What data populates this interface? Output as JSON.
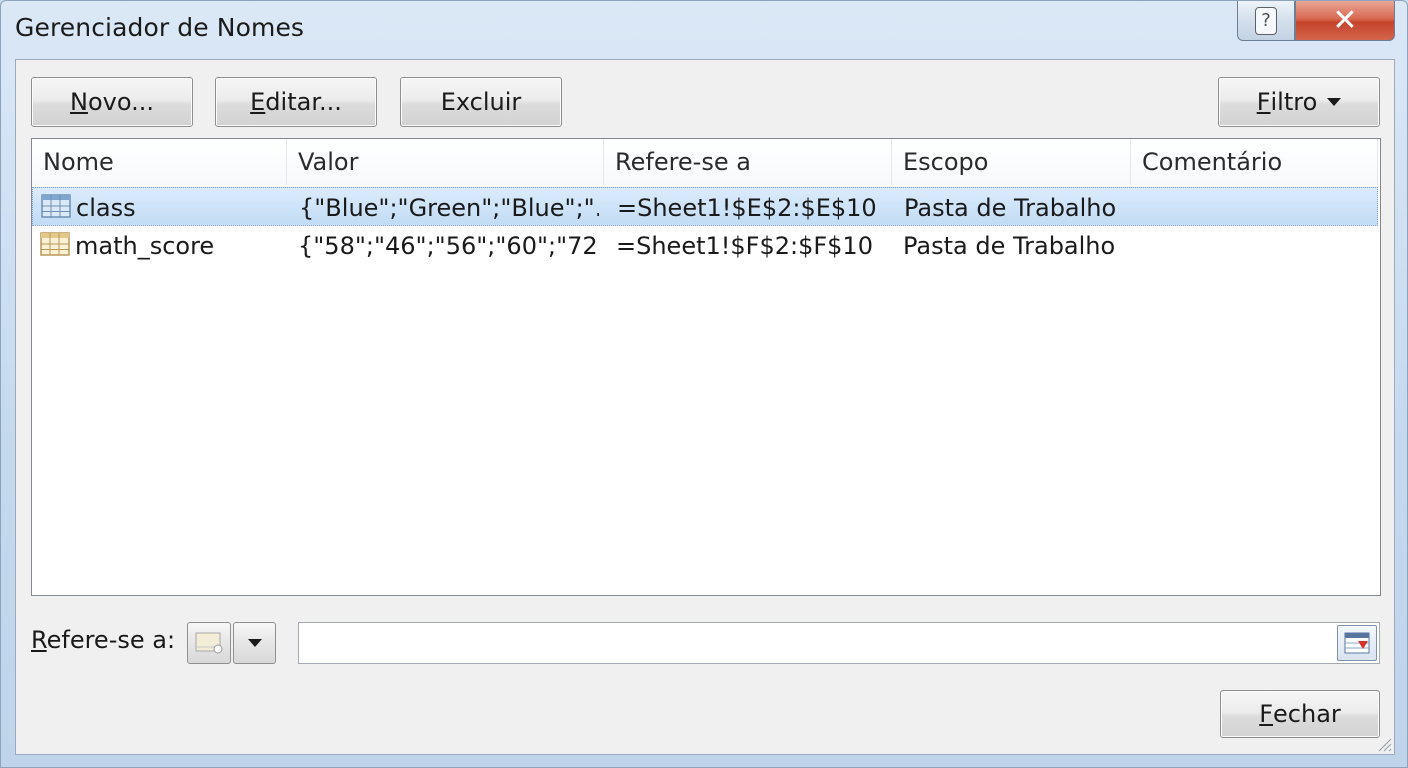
{
  "window": {
    "title": "Gerenciador de Nomes",
    "help_glyph": "?",
    "close_glyph": "✕"
  },
  "toolbar": {
    "new_label_first": "N",
    "new_label_rest": "ovo...",
    "edit_label_first": "E",
    "edit_label_rest": "ditar...",
    "delete_label": "Excluir",
    "filter_label_first": "F",
    "filter_label_rest": "iltro"
  },
  "table": {
    "columns": [
      "Nome",
      "Valor",
      "Refere-se a",
      "Escopo",
      "Comentário"
    ],
    "rows": [
      {
        "name": "class",
        "value": "{\"Blue\";\"Green\";\"Blue\";\"...",
        "refers_to": "=Sheet1!$E$2:$E$10",
        "scope": "Pasta de Trabalho",
        "comment": "",
        "icon": "range-name-icon",
        "selected": true
      },
      {
        "name": "math_score",
        "value": "{\"58\";\"46\";\"56\";\"60\";\"72...",
        "refers_to": "=Sheet1!$F$2:$F$10",
        "scope": "Pasta de Trabalho",
        "comment": "",
        "icon": "range-name-icon",
        "selected": false
      }
    ]
  },
  "refers": {
    "label_first": "R",
    "label_rest": "efere-se a:",
    "value": ""
  },
  "footer": {
    "close_first": "F",
    "close_rest": "echar"
  },
  "colors": {
    "selection": "#c1dcf5",
    "close_button": "#c5432b"
  }
}
